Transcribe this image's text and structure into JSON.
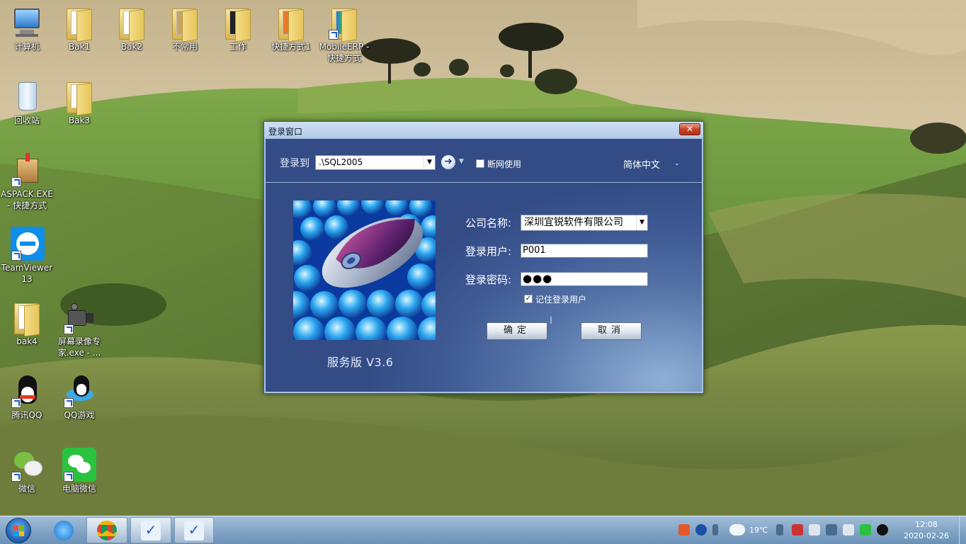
{
  "desktop": {
    "icons": [
      {
        "label": "计算机"
      },
      {
        "label": "Bak1"
      },
      {
        "label": "Bak2"
      },
      {
        "label": "不常用"
      },
      {
        "label": "工作"
      },
      {
        "label": "快捷方式1"
      },
      {
        "label": "MobileERP - 快捷方式"
      },
      {
        "label": "回收站"
      },
      {
        "label": "Bak3"
      },
      {
        "label": "ASPACK.EXE - 快捷方式"
      },
      {
        "label": "TeamViewer 13"
      },
      {
        "label": "bak4"
      },
      {
        "label": "屏幕录像专家.exe - ..."
      },
      {
        "label": "腾讯QQ"
      },
      {
        "label": "QQ游戏"
      },
      {
        "label": "微信"
      },
      {
        "label": "电脑微信"
      }
    ]
  },
  "dialog": {
    "title": "登录窗口",
    "close_label": "✕",
    "login_to_label": "登录到",
    "server_value": ".\\SQL2005",
    "offline_label": "断网使用",
    "offline_checked": false,
    "language": "简体中文",
    "version": "服务版 V3.6",
    "company_label": "公司名称:",
    "company_value": "深圳宜锐软件有限公司",
    "user_label": "登录用户:",
    "user_value": "P001",
    "password_label": "登录密码:",
    "password_mask": "●●●",
    "remember_label": "记住登录用户",
    "remember_checked": true,
    "ok_label": "确定",
    "cancel_label": "取消"
  },
  "taskbar": {
    "weather_temp": "19℃",
    "time": "12:08",
    "date": "2020-02-26"
  },
  "colors": {
    "dialog_accent": "#3e5993",
    "taskbar": "#86a8c9",
    "close_button": "#c7432a"
  }
}
